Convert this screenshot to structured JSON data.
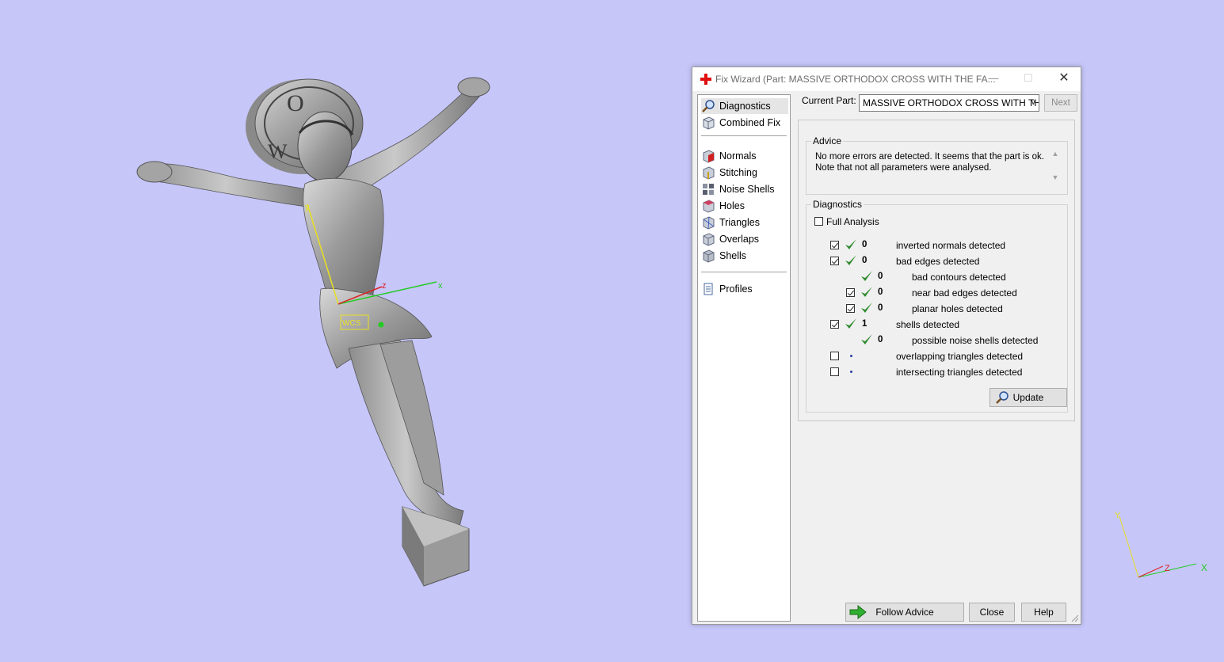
{
  "viewport": {
    "background": "#c6c6f9",
    "axis_labels": {
      "x": "x",
      "y": "y",
      "z": "z"
    },
    "wcs_label": "WCS",
    "corner_axis_labels": {
      "x": "X",
      "y": "Y",
      "z": "Z"
    }
  },
  "dialog": {
    "title": "Fix Wizard (Part: MASSIVE ORTHODOX CROSS WITH THE FA...",
    "nav_items": [
      {
        "label": "Diagnostics",
        "icon": "magnifier-icon",
        "selected": true
      },
      {
        "label": "Combined Fix",
        "icon": "cube-icon"
      },
      {
        "label": "Normals",
        "icon": "normals-cube-icon"
      },
      {
        "label": "Stitching",
        "icon": "stitching-cube-icon"
      },
      {
        "label": "Noise Shells",
        "icon": "noise-shells-icon"
      },
      {
        "label": "Holes",
        "icon": "holes-cube-icon"
      },
      {
        "label": "Triangles",
        "icon": "triangles-cube-icon"
      },
      {
        "label": "Overlaps",
        "icon": "overlaps-cube-icon"
      },
      {
        "label": "Shells",
        "icon": "shells-cube-icon"
      },
      {
        "label": "Profiles",
        "icon": "profiles-icon"
      }
    ],
    "current_part_label": "Current Part:",
    "current_part_value": "MASSIVE ORTHODOX CROSS WITH THE FACE OF CHRIST",
    "next_label": "Next",
    "advice": {
      "title": "Advice",
      "text": "No more errors are detected. It seems that the part is ok. Note that not all parameters were analysed."
    },
    "diagnostics": {
      "title": "Diagnostics",
      "full_analysis_label": "Full Analysis",
      "full_analysis_checked": false,
      "rows": [
        {
          "checkbox": true,
          "checked": true,
          "status": "ok",
          "count": "0",
          "label": "inverted normals detected",
          "indent": 0
        },
        {
          "checkbox": true,
          "checked": true,
          "status": "ok",
          "count": "0",
          "label": "bad edges detected",
          "indent": 0
        },
        {
          "checkbox": false,
          "checked": false,
          "status": "ok",
          "count": "0",
          "label": "bad contours detected",
          "indent": 1
        },
        {
          "checkbox": true,
          "checked": true,
          "status": "ok",
          "count": "0",
          "label": "near bad edges detected",
          "indent": 1
        },
        {
          "checkbox": true,
          "checked": true,
          "status": "ok",
          "count": "0",
          "label": "planar holes detected",
          "indent": 1
        },
        {
          "checkbox": true,
          "checked": true,
          "status": "ok",
          "count": "1",
          "label": "shells detected",
          "indent": 0
        },
        {
          "checkbox": false,
          "checked": false,
          "status": "ok",
          "count": "0",
          "label": "possible noise shells detected",
          "indent": 1
        },
        {
          "checkbox": true,
          "checked": false,
          "status": "none",
          "count": "",
          "label": "overlapping triangles detected",
          "indent": 0
        },
        {
          "checkbox": true,
          "checked": false,
          "status": "none",
          "count": "",
          "label": "intersecting triangles detected",
          "indent": 0
        }
      ],
      "update_label": "Update"
    },
    "buttons": {
      "follow_advice": "Follow Advice",
      "close": "Close",
      "help": "Help"
    }
  },
  "colors": {
    "check_green": "#2e8b2e",
    "dialog_bg": "#f0f0f0"
  }
}
